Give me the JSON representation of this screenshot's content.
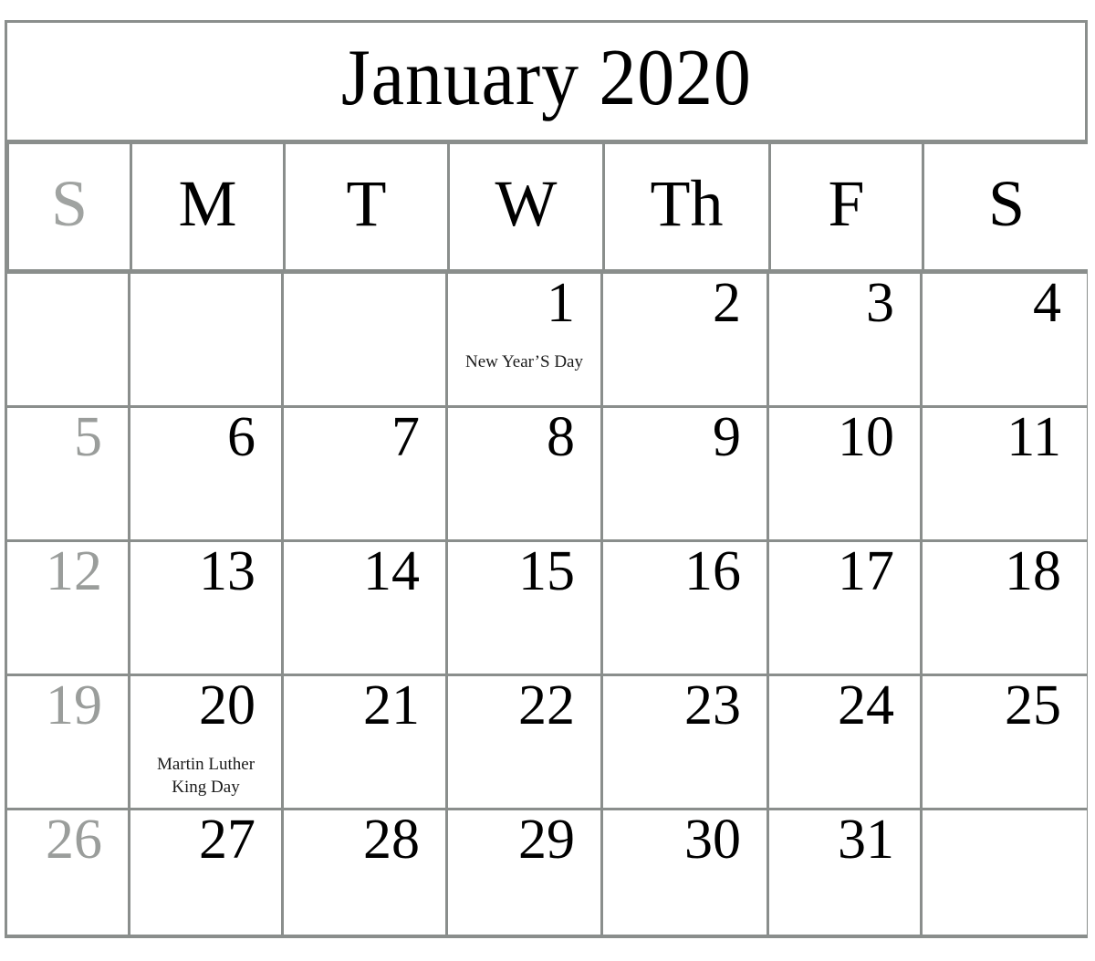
{
  "calendar": {
    "title": "January 2020",
    "month": "January",
    "year": "2020",
    "weekday_headers": [
      {
        "label": "S",
        "name": "sunday",
        "muted": true
      },
      {
        "label": "M",
        "name": "monday",
        "muted": false
      },
      {
        "label": "T",
        "name": "tuesday",
        "muted": false
      },
      {
        "label": "W",
        "name": "wednesday",
        "muted": false
      },
      {
        "label": "Th",
        "name": "thursday",
        "muted": false
      },
      {
        "label": "F",
        "name": "friday",
        "muted": false
      },
      {
        "label": "S",
        "name": "saturday",
        "muted": false
      }
    ],
    "colors": {
      "border": "#8a8e8c",
      "text": "#000000",
      "muted_text": "#9a9d9b",
      "background": "#ffffff"
    },
    "weeks": [
      [
        {
          "date": "",
          "event": ""
        },
        {
          "date": "",
          "event": ""
        },
        {
          "date": "",
          "event": ""
        },
        {
          "date": "1",
          "event": "New Year’S Day"
        },
        {
          "date": "2",
          "event": ""
        },
        {
          "date": "3",
          "event": ""
        },
        {
          "date": "4",
          "event": ""
        }
      ],
      [
        {
          "date": "5",
          "event": ""
        },
        {
          "date": "6",
          "event": ""
        },
        {
          "date": "7",
          "event": ""
        },
        {
          "date": "8",
          "event": ""
        },
        {
          "date": "9",
          "event": ""
        },
        {
          "date": "10",
          "event": ""
        },
        {
          "date": "11",
          "event": ""
        }
      ],
      [
        {
          "date": "12",
          "event": ""
        },
        {
          "date": "13",
          "event": ""
        },
        {
          "date": "14",
          "event": ""
        },
        {
          "date": "15",
          "event": ""
        },
        {
          "date": "16",
          "event": ""
        },
        {
          "date": "17",
          "event": ""
        },
        {
          "date": "18",
          "event": ""
        }
      ],
      [
        {
          "date": "19",
          "event": ""
        },
        {
          "date": "20",
          "event": "Martin Luther\nKing Day"
        },
        {
          "date": "21",
          "event": ""
        },
        {
          "date": "22",
          "event": ""
        },
        {
          "date": "23",
          "event": ""
        },
        {
          "date": "24",
          "event": ""
        },
        {
          "date": "25",
          "event": ""
        }
      ],
      [
        {
          "date": "26",
          "event": ""
        },
        {
          "date": "27",
          "event": ""
        },
        {
          "date": "28",
          "event": ""
        },
        {
          "date": "29",
          "event": ""
        },
        {
          "date": "30",
          "event": ""
        },
        {
          "date": "31",
          "event": ""
        },
        {
          "date": "",
          "event": ""
        }
      ]
    ]
  }
}
